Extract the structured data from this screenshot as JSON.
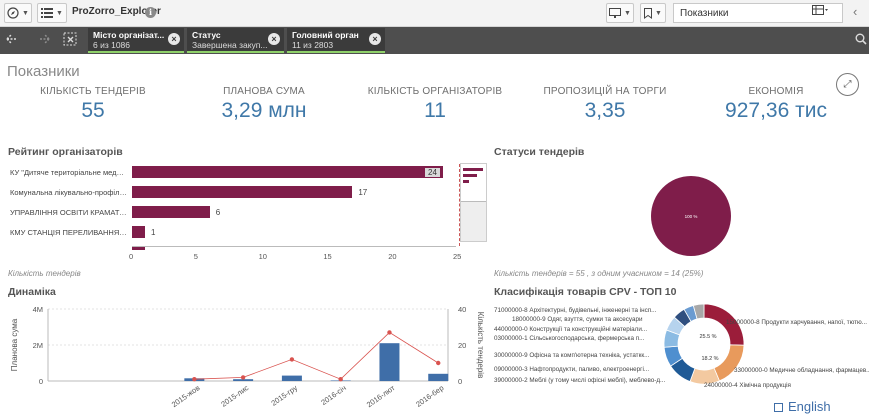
{
  "toolbar": {
    "app_title": "ProZorro_Explorer",
    "sheet_name": "Показники"
  },
  "selections": [
    {
      "title": "Місто організат...",
      "value": "6 из 1086"
    },
    {
      "title": "Статус",
      "value": "Завершена закуп..."
    },
    {
      "title": "Головний орган",
      "value": "11 из 2803"
    }
  ],
  "sheet": {
    "title": "Показники"
  },
  "kpis": [
    {
      "label": "КІЛЬКІСТЬ ТЕНДЕРІВ",
      "value": "55"
    },
    {
      "label": "ПЛАНОВА СУМА",
      "value": "3,29 млн"
    },
    {
      "label": "КІЛЬКІСТЬ ОРГАНІЗАТОРІВ",
      "value": "11"
    },
    {
      "label": "ПРОПОЗИЦІЙ НА ТОРГИ",
      "value": "3,35"
    },
    {
      "label": "ЕКОНОМІЯ",
      "value": "927,36 тис"
    }
  ],
  "rating": {
    "title": "Рейтинг організаторів",
    "footnote": "Кількість тендерів"
  },
  "statuses": {
    "title": "Статуси тендерів",
    "footnote": "Кількість тендерів = 55 , з одним учасником = 14 (25%)",
    "pie_label": "100 %"
  },
  "dynamics": {
    "title": "Динаміка",
    "y_left_label": "Планова сума",
    "y_right_label": "Кількість тендерів"
  },
  "cpv": {
    "title": "Класифікація товарів CPV - ТОП 10",
    "center_labels": [
      "25.5 %",
      "18.2 %"
    ]
  },
  "colors": {
    "bar": "#7f1d4a",
    "kpi_value": "#3f78a8",
    "dyn_bar": "#3f6ea8",
    "dyn_line": "#d9534f",
    "selection_accent": "#8fd16a"
  },
  "footer": {
    "language": "English"
  },
  "chart_data": [
    {
      "type": "bar",
      "orientation": "horizontal",
      "title": "Рейтинг організаторів",
      "xlabel": "Кількість тендерів",
      "categories": [
        "КУ \"Дитяче територіальне медичн...",
        "Комунальна лікувально-профілак...",
        "УПРАВЛІННЯ ОСВІТИ КРАМАТОР...",
        "КМУ СТАНЦІЯ ПЕРЕЛИВАННЯ КР..."
      ],
      "values": [
        24,
        17,
        6,
        1
      ],
      "xlim": [
        0,
        25
      ],
      "xticks": [
        0,
        5,
        10,
        15,
        20,
        25
      ]
    },
    {
      "type": "pie",
      "title": "Статуси тендерів",
      "slices": [
        {
          "label": "100 %",
          "value": 100
        }
      ]
    },
    {
      "type": "bar",
      "title": "Динаміка",
      "ylabel": "Планова сума",
      "y2label": "Кількість тендерів",
      "categories": [
        "2015-жов",
        "2015-лис",
        "2015-гру",
        "2016-січ",
        "2016-лют",
        "2016-бер"
      ],
      "series": [
        {
          "name": "Планова сума",
          "kind": "bar",
          "axis": "left",
          "values": [
            150000,
            100000,
            300000,
            30000,
            2100000,
            400000
          ]
        },
        {
          "name": "Кількість тендерів",
          "kind": "line",
          "axis": "right",
          "values": [
            1,
            2,
            12,
            1,
            27,
            10
          ]
        }
      ],
      "ylim": [
        0,
        4000000
      ],
      "yticks": [
        "0",
        "2M",
        "4M"
      ],
      "y2lim": [
        0,
        40
      ],
      "y2ticks": [
        "0",
        "20",
        "40"
      ]
    },
    {
      "type": "pie",
      "donut": true,
      "title": "Класифікація товарів CPV - ТОП 10",
      "labels": [
        "15000000-8 Продукти харчування, напої, тютю...",
        "33000000-0 Медичне обладнання, фармацев...",
        "24000000-4 Хімічна продукція",
        "39000000-2 Меблі (у тому числі офісні меблі), меблево-д...",
        "09000000-3 Нафтопродукти, паливо, електроенергі...",
        "30000000-9 Офісна та комп'ютерна техніка, устаткк...",
        "03000000-1 Сільськогосподарська, фермерська п...",
        "44000000-0 Конструкції та конструкційні матеріали...",
        "18000000-9 Одяг, взуття, сумки та аксесуари",
        "71000000-8 Архітектурні, будівельні, інженерні та інсп..."
      ],
      "values": [
        25.5,
        18.2,
        12,
        10,
        8,
        7,
        6,
        5,
        4,
        4.3
      ]
    }
  ]
}
